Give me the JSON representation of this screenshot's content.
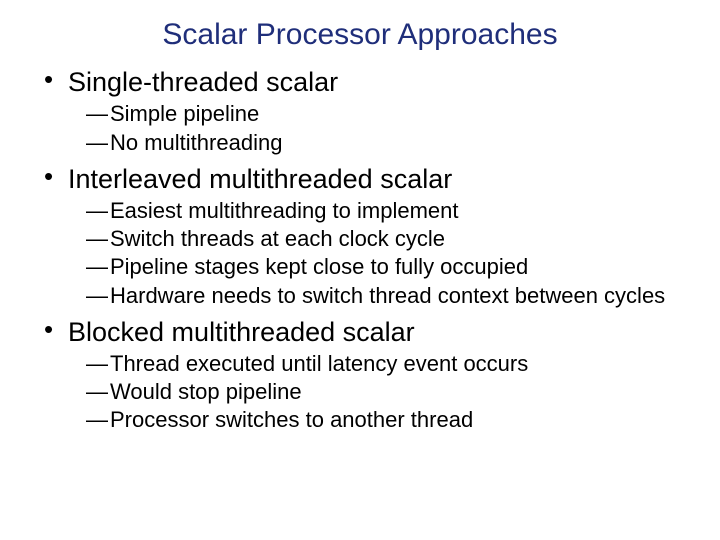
{
  "title": "Scalar Processor Approaches",
  "items": [
    {
      "label": "Single-threaded scalar",
      "sub": [
        "Simple pipeline",
        "No multithreading"
      ]
    },
    {
      "label": "Interleaved multithreaded scalar",
      "sub": [
        "Easiest multithreading to implement",
        "Switch threads at each clock cycle",
        "Pipeline stages kept close to fully occupied",
        "Hardware needs to switch thread context between cycles"
      ]
    },
    {
      "label": "Blocked multithreaded scalar",
      "sub": [
        "Thread executed until latency event occurs",
        "Would stop pipeline",
        "Processor switches to another thread"
      ]
    }
  ]
}
